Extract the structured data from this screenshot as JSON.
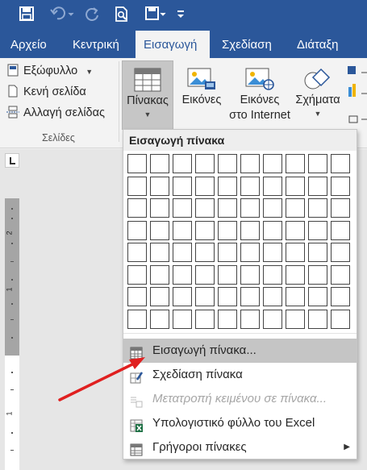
{
  "quick_access": {
    "save_icon": "save-icon",
    "undo_icon": "undo-icon",
    "redo_icon": "redo-icon",
    "print_preview_icon": "print-preview-icon",
    "save_as_icon": "save-as-icon",
    "customize_icon": "customize-toolbar-icon"
  },
  "tabs": [
    {
      "label": "Αρχείο"
    },
    {
      "label": "Κεντρική"
    },
    {
      "label": "Εισαγωγή",
      "active": true
    },
    {
      "label": "Σχεδίαση"
    },
    {
      "label": "Διάταξη"
    }
  ],
  "ribbon": {
    "pages_group": {
      "cover_page": "Εξώφυλλο",
      "blank_page": "Κενή σελίδα",
      "page_break": "Αλλαγή σελίδας",
      "label": "Σελίδες"
    },
    "tables": {
      "label": "Πίνακας"
    },
    "pictures": {
      "label": "Εικόνες"
    },
    "online_pictures": {
      "line1": "Εικόνες",
      "line2": "στο Internet"
    },
    "shapes": {
      "label": "Σχήματα"
    }
  },
  "dropdown": {
    "header": "Εισαγωγή πίνακα",
    "grid_columns": 10,
    "grid_rows": 8,
    "items": [
      {
        "label": "Εισαγωγή πίνακα...",
        "icon": "insert-table-icon",
        "highlighted": true
      },
      {
        "label": "Σχεδίαση πίνακα",
        "icon": "draw-table-icon"
      },
      {
        "label": "Μετατροπή κειμένου σε πίνακα...",
        "icon": "convert-text-icon",
        "disabled": true
      },
      {
        "label": "Υπολογιστικό φύλλο του Excel",
        "icon": "excel-icon"
      },
      {
        "label": "Γρήγοροι πίνακες",
        "icon": "quick-tables-icon",
        "has_submenu": true
      }
    ]
  },
  "ruler": {
    "numbers": [
      "2",
      "1",
      "1"
    ]
  },
  "annotation": {
    "arrow_color": "#e02020"
  },
  "colors": {
    "accent": "#2b579a"
  }
}
